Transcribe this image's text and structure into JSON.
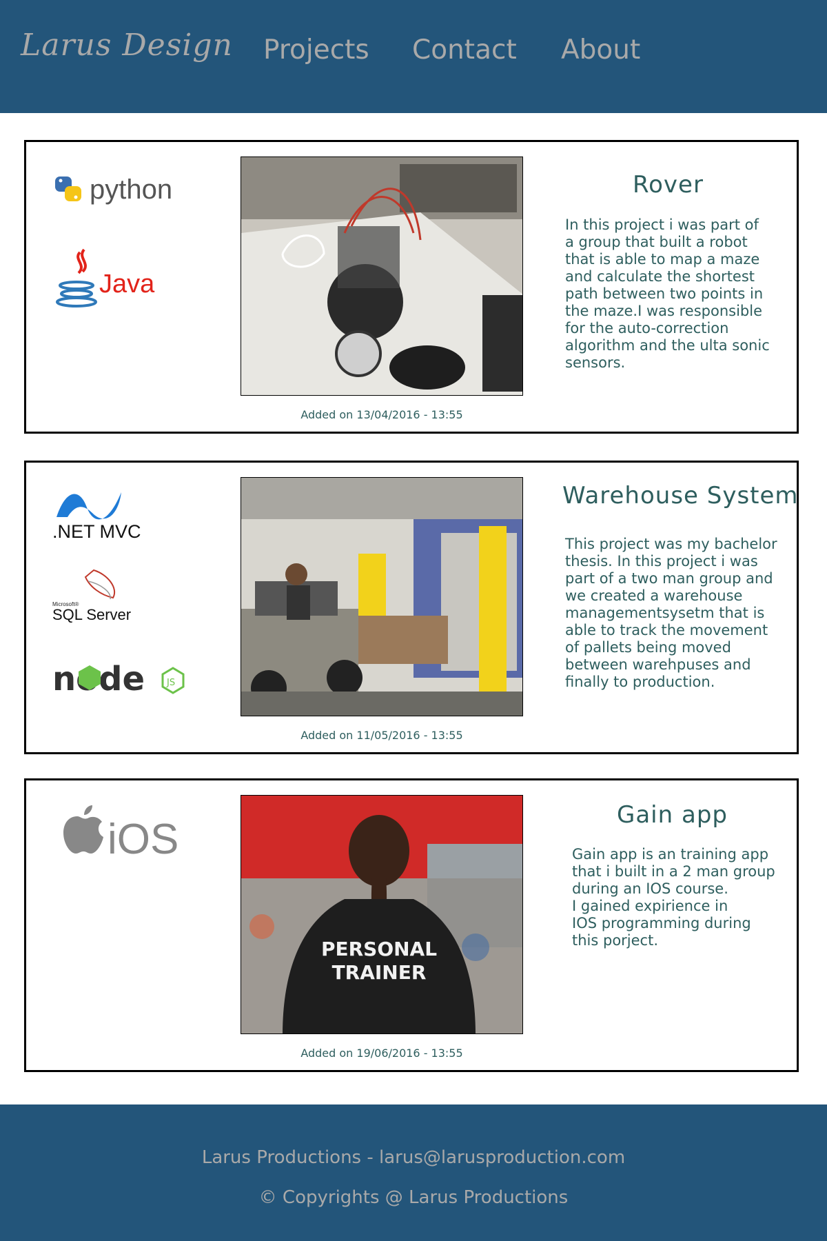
{
  "header": {
    "brand": "Larus Design",
    "nav": [
      {
        "label": "Projects"
      },
      {
        "label": "Contact"
      },
      {
        "label": "About"
      }
    ]
  },
  "projects": [
    {
      "title": "Rover",
      "description": "In this project i was part of\na group that built a robot\nthat is able to map a maze\nand calculate the shortest\npath between two points in\nthe maze.I was responsible\nfor the auto-correction\nalgorithm and the ulta sonic\nsensors.",
      "date": "Added on 13/04/2016 - 13:55",
      "logos": [
        {
          "name": "python-logo",
          "text": "python"
        },
        {
          "name": "java-logo",
          "text": "Java"
        }
      ],
      "photo_icon": "robot-rover-photo"
    },
    {
      "title": "Warehouse System",
      "description": "This project was my bachelor\nthesis. In this project i was\npart of a two man group and\nwe created a warehouse\n managementsysetm that is\nable to track the movement\nof pallets being moved\nbetween warehpuses and\nfinally to production.",
      "date": "Added on 11/05/2016 - 13:55",
      "logos": [
        {
          "name": "dotnet-mvc-logo",
          "text": ".NET MVC"
        },
        {
          "name": "sql-server-logo",
          "text": "SQL Server",
          "subtext": "Microsoft®"
        },
        {
          "name": "nodejs-logo",
          "text": "node",
          "badge": "JS"
        }
      ],
      "photo_icon": "forklift-warehouse-photo"
    },
    {
      "title": "Gain app",
      "description": "Gain app is an training app\nthat i built in a 2 man group\nduring an IOS course.\nI gained  expirience in\nIOS programming during\nthis porject.",
      "date": "Added on 19/06/2016 - 13:55",
      "logos": [
        {
          "name": "ios-logo",
          "text": "iOS"
        }
      ],
      "photo_icon": "personal-trainer-photo",
      "photo_caption": "PERSONAL\nTRAINER"
    }
  ],
  "footer": {
    "line1": "Larus Productions - larus@larusproduction.com",
    "line2": "© Copyrights @ Larus Productions"
  },
  "colors": {
    "header_bg": "#23557a",
    "nav_text": "#a9a9a9",
    "body_text": "#2e5e5e"
  }
}
